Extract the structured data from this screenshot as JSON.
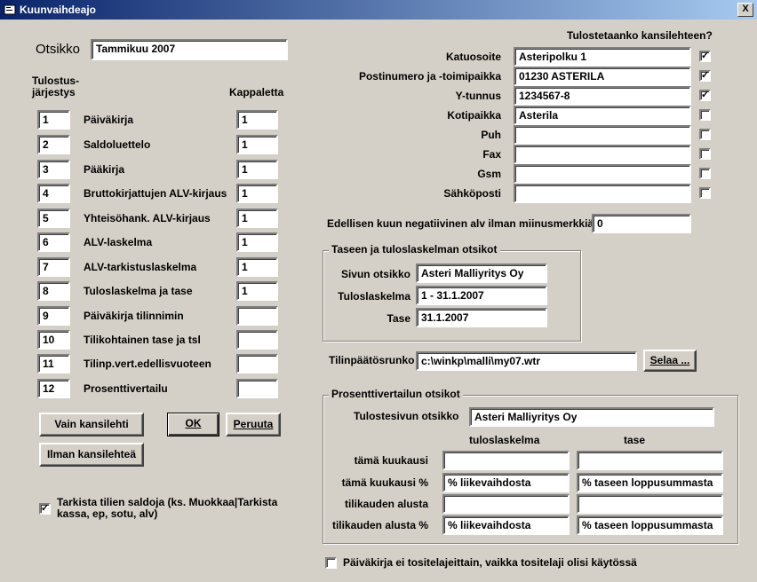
{
  "window": {
    "title": "Kuunvaihdeajo",
    "close_label": "X"
  },
  "header": {
    "otsikko_label": "Otsikko",
    "otsikko_value": "Tammikuu 2007"
  },
  "reports": {
    "order_header_line1": "Tulostus-",
    "order_header_line2": "järjestys",
    "copies_header": "Kappaletta",
    "rows": [
      {
        "order": "1",
        "name": "Päiväkirja",
        "copies": "1"
      },
      {
        "order": "2",
        "name": "Saldoluettelo",
        "copies": "1"
      },
      {
        "order": "3",
        "name": "Pääkirja",
        "copies": "1"
      },
      {
        "order": "4",
        "name": "Bruttokirjattujen ALV-kirjaus",
        "copies": "1"
      },
      {
        "order": "5",
        "name": "Yhteisöhank. ALV-kirjaus",
        "copies": "1"
      },
      {
        "order": "6",
        "name": "ALV-laskelma",
        "copies": "1"
      },
      {
        "order": "7",
        "name": "ALV-tarkistuslaskelma",
        "copies": "1"
      },
      {
        "order": "8",
        "name": "Tuloslaskelma ja tase",
        "copies": "1"
      },
      {
        "order": "9",
        "name": "Päiväkirja tilinnimin",
        "copies": ""
      },
      {
        "order": "10",
        "name": "Tilikohtainen tase ja tsl",
        "copies": ""
      },
      {
        "order": "11",
        "name": "Tilinp.vert.edellisvuoteen",
        "copies": ""
      },
      {
        "order": "12",
        "name": "Prosenttivertailu",
        "copies": ""
      }
    ]
  },
  "buttons": {
    "vain_kansilehti": "Vain kansilehti",
    "ok": "OK",
    "peruuta": "Peruuta",
    "ilman_kansilehtea": "Ilman kansilehteä",
    "selaa": "Selaa ..."
  },
  "check_balances": {
    "label_line1": "Tarkista tilien saldoja (ks. Muokkaa|Tarkista",
    "label_line2": "kassa, ep, sotu, alv)",
    "checked": true
  },
  "cover": {
    "question": "Tulostetaanko kansilehteen?",
    "fields": [
      {
        "label": "Katuosoite",
        "value": "Asteripolku 1",
        "checked": true
      },
      {
        "label": "Postinumero ja -toimipaikka",
        "value": "01230  ASTERILA",
        "checked": true
      },
      {
        "label": "Y-tunnus",
        "value": "1234567-8",
        "checked": true
      },
      {
        "label": "Kotipaikka",
        "value": "Asterila",
        "checked": false
      },
      {
        "label": "Puh",
        "value": "",
        "checked": false
      },
      {
        "label": "Fax",
        "value": "",
        "checked": false
      },
      {
        "label": "Gsm",
        "value": "",
        "checked": false
      },
      {
        "label": "Sähköposti",
        "value": "",
        "checked": false
      }
    ]
  },
  "negative_vat": {
    "label": "Edellisen kuun negatiivinen alv ilman miinusmerkkiä",
    "value": "0"
  },
  "headings_group": {
    "caption": "Taseen ja tuloslaskelman otsikot",
    "sivun_otsikko_label": "Sivun otsikko",
    "sivun_otsikko_value": "Asteri Malliyritys Oy",
    "tuloslaskelma_label": "Tuloslaskelma",
    "tuloslaskelma_value": "1 - 31.1.2007",
    "tase_label": "Tase",
    "tase_value": "31.1.2007"
  },
  "template": {
    "label": "Tilinpäätösrunko",
    "value": "c:\\winkp\\malli\\my07.wtr"
  },
  "percent_group": {
    "caption": "Prosenttivertailun otsikot",
    "page_title_label": "Tulostesivun otsikko",
    "page_title_value": "Asteri Malliyritys Oy",
    "col1_header": "tuloslaskelma",
    "col2_header": "tase",
    "rows": [
      {
        "label": "tämä kuukausi",
        "col1": "",
        "col2": ""
      },
      {
        "label": "tämä kuukausi %",
        "col1": "% liikevaihdosta",
        "col2": "% taseen loppusummasta"
      },
      {
        "label": "tilikauden alusta",
        "col1": "",
        "col2": ""
      },
      {
        "label": "tilikauden alusta %",
        "col1": "% liikevaihdosta",
        "col2": "% taseen loppusummasta"
      }
    ]
  },
  "journal_option": {
    "label": "Päiväkirja ei tositelajeittain, vaikka tositelaji olisi käytössä",
    "checked": false
  }
}
